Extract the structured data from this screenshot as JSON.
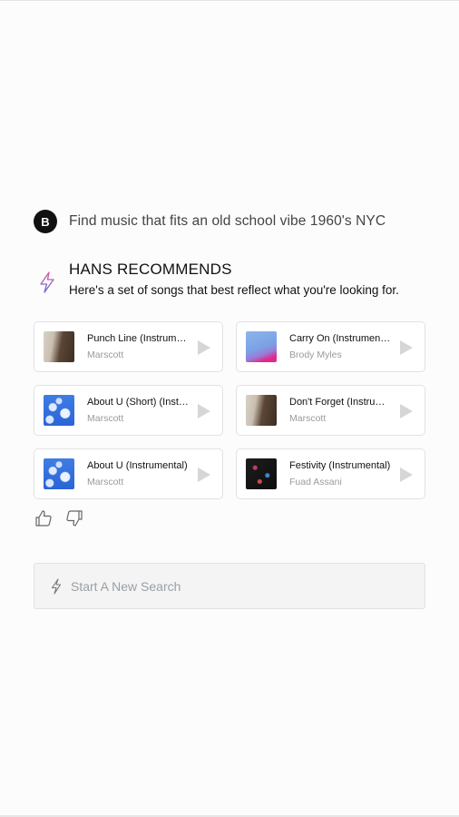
{
  "query": {
    "avatar_letter": "B",
    "text": "Find music that fits an old school vibe 1960's NYC"
  },
  "recommendations": {
    "icon": "bolt-icon",
    "title": "HANS RECOMMENDS",
    "subtitle": "Here's a set of songs that best reflect what you're looking for.",
    "songs": [
      {
        "title": "Punch Line (Instrumental)",
        "artist": "Marscott",
        "thumb": "guitar"
      },
      {
        "title": "Carry On (Instrumental)",
        "artist": "Brody Myles",
        "thumb": "pink-wall"
      },
      {
        "title": "About U (Short) (Instrumental)",
        "artist": "Marscott",
        "thumb": "clouds"
      },
      {
        "title": "Don't Forget (Instrumental)",
        "artist": "Marscott",
        "thumb": "guitar"
      },
      {
        "title": "About U (Instrumental)",
        "artist": "Marscott",
        "thumb": "clouds"
      },
      {
        "title": "Festivity (Instrumental)",
        "artist": "Fuad Assani",
        "thumb": "dark-lights"
      }
    ]
  },
  "feedback": {
    "like_icon": "thumbs-up-icon",
    "dislike_icon": "thumbs-down-icon"
  },
  "search": {
    "placeholder": "Start A New Search",
    "icon": "bolt-icon"
  },
  "colors": {
    "accent_gradient": [
      "#e05a9a",
      "#5a6ae0"
    ],
    "avatar": "#111111"
  }
}
